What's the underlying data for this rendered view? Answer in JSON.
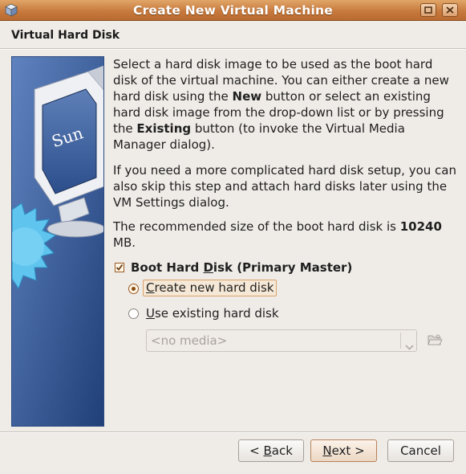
{
  "window": {
    "title": "Create New Virtual Machine",
    "app_icon": "virtualbox-cube-icon",
    "controls": [
      "maximize-icon",
      "close-icon"
    ]
  },
  "page": {
    "heading": "Virtual Hard Disk"
  },
  "side_panel": {
    "image": "virtualbox-monitor-graphic",
    "monitor_logo": "Sun"
  },
  "description": {
    "p1_a": "Select a hard disk image to be used as the boot hard disk of the virtual machine. You can either create a new hard disk using the ",
    "p1_b": "New",
    "p1_c": " button or select an existing hard disk image from the drop-down list or by pressing the ",
    "p1_d": "Existing",
    "p1_e": " button (to invoke the Virtual Media Manager dialog).",
    "p2": "If you need a more complicated hard disk setup, you can also skip this step and attach hard disks later using the VM Settings dialog.",
    "p3_a": "The recommended size of the boot hard disk is ",
    "p3_size": "10240",
    "p3_unit": " MB."
  },
  "boot_disk": {
    "checked": true,
    "label_pre": "Boot Hard ",
    "label_mnemonic": "D",
    "label_post": "isk (Primary Master)",
    "options": {
      "create": {
        "mnemonic": "C",
        "rest": "reate new hard disk",
        "selected": true
      },
      "existing": {
        "mnemonic": "U",
        "rest": "se existing hard disk",
        "selected": false
      }
    },
    "media_select": {
      "value": "<no media>",
      "enabled": false
    },
    "browse_icon": "folder-open-icon"
  },
  "buttons": {
    "back_pre": "< ",
    "back_mnemonic": "B",
    "back_rest": "ack",
    "next_mnemonic": "N",
    "next_rest": "ext >",
    "cancel": "Cancel"
  },
  "colors": {
    "titlebar": "#c87a3e",
    "accent": "#d9a36a",
    "side_panel": "#3a61a0"
  }
}
